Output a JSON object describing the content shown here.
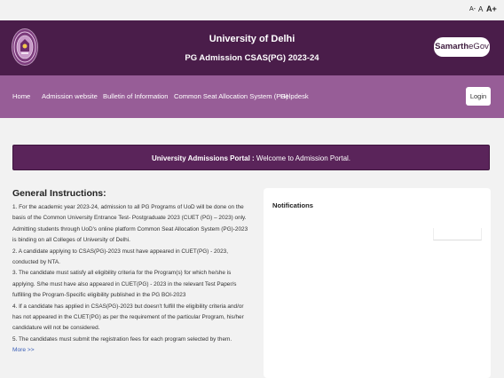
{
  "font_controls": {
    "decrease": "A-",
    "normal": "A",
    "increase": "A+"
  },
  "header": {
    "title": "University of Delhi",
    "subtitle": "PG Admission CSAS(PG) 2023-24",
    "brand_bold": "Samarth",
    "brand_light": "eGov",
    "logo_icon": "university-seal-icon",
    "bg_color": "#4a1d4a"
  },
  "nav": {
    "items": [
      {
        "label": "Home"
      },
      {
        "label": "Admission website"
      },
      {
        "label": "Bulletin of Information"
      },
      {
        "label": "Common Seat Allocation System (PG)"
      },
      {
        "label": "Helpdesk"
      }
    ],
    "login_label": "Login",
    "bg_color": "#975d97"
  },
  "banner": {
    "bold": "University Admissions Portal :",
    "text": " Welcome to Admission Portal."
  },
  "instructions": {
    "heading": "General Instructions:",
    "items": [
      "1. For the academic year 2023-24, admission to all PG Programs of UoD will be done on the basis of the Common University Entrance Test- Postgraduate 2023 (CUET (PG) – 2023) only. Admitting students through UoD's online platform Common Seat Allocation System (PG)-2023 is binding on all Colleges of University of Delhi.",
      "2. A candidate applying to CSAS(PG)-2023 must have appeared in CUET(PG) - 2023, conducted by NTA.",
      "3. The candidate must satisfy all eligibility criteria for the Program(s) for which he/she is applying. S/he must have also appeared in CUET(PG) - 2023 in the relevant Test Paper/s fulfilling the Program-Specific eligibility published in the PG BOI-2023",
      "4. If a candidate has applied in CSAS(PG)-2023 but doesn't fulfill the eligibility criteria and/or has not appeared in the CUET(PG) as per the requirement of the particular Program, his/her candidature will not be considered.",
      "5. The candidates must submit the registration fees for each program selected by them."
    ],
    "more_label": "More >>"
  },
  "notifications": {
    "title": "Notifications"
  }
}
